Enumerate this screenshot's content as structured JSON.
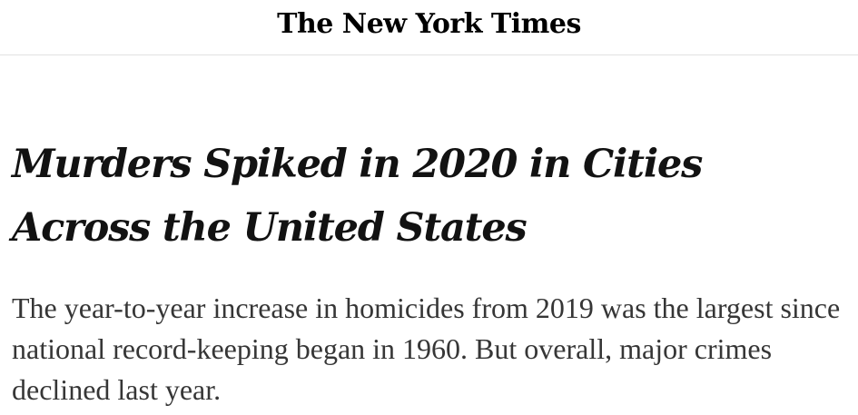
{
  "masthead": {
    "logo_text": "The New York Times"
  },
  "article": {
    "headline": "Murders Spiked in 2020 in Cities Across the United States",
    "summary": "The year-to-year increase in homicides from 2019 was the largest since national record-keeping began in 1960. But overall, major crimes declined last year."
  }
}
